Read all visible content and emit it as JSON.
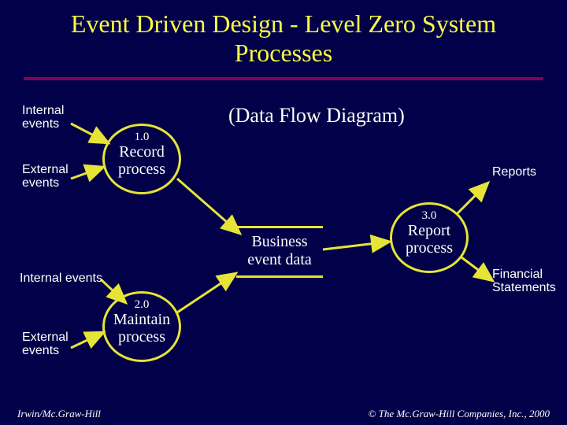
{
  "title": "Event Driven Design - Level Zero System Processes",
  "subtitle": "(Data Flow Diagram)",
  "labels": {
    "internal1": "Internal\nevents",
    "external1": "External\nevents",
    "internal2": "Internal events",
    "external2": "External\nevents",
    "reports": "Reports",
    "financial": "Financial\nStatements"
  },
  "processes": {
    "p1": {
      "id": "1.0",
      "name": "Record\nprocess"
    },
    "p2": {
      "id": "2.0",
      "name": "Maintain\nprocess"
    },
    "p3": {
      "id": "3.0",
      "name": "Report\nprocess"
    }
  },
  "datastore": {
    "name": "Business\nevent data"
  },
  "footer": {
    "left": "Irwin/Mc.Graw-Hill",
    "right": "© The Mc.Graw-Hill Companies, Inc., 2000"
  },
  "chart_data": {
    "type": "diagram",
    "title": "Event Driven Design - Level Zero System Processes (Data Flow Diagram)",
    "nodes": [
      {
        "id": "internal1",
        "type": "external-entity",
        "label": "Internal events"
      },
      {
        "id": "external1",
        "type": "external-entity",
        "label": "External events"
      },
      {
        "id": "internal2",
        "type": "external-entity",
        "label": "Internal events"
      },
      {
        "id": "external2",
        "type": "external-entity",
        "label": "External events"
      },
      {
        "id": "reports",
        "type": "external-entity",
        "label": "Reports"
      },
      {
        "id": "financial",
        "type": "external-entity",
        "label": "Financial Statements"
      },
      {
        "id": "p1",
        "type": "process",
        "number": "1.0",
        "label": "Record process"
      },
      {
        "id": "p2",
        "type": "process",
        "number": "2.0",
        "label": "Maintain process"
      },
      {
        "id": "p3",
        "type": "process",
        "number": "3.0",
        "label": "Report process"
      },
      {
        "id": "ds",
        "type": "data-store",
        "label": "Business event data"
      }
    ],
    "edges": [
      {
        "from": "internal1",
        "to": "p1"
      },
      {
        "from": "external1",
        "to": "p1"
      },
      {
        "from": "internal2",
        "to": "p2"
      },
      {
        "from": "external2",
        "to": "p2"
      },
      {
        "from": "p1",
        "to": "ds"
      },
      {
        "from": "p2",
        "to": "ds"
      },
      {
        "from": "ds",
        "to": "p3"
      },
      {
        "from": "p3",
        "to": "reports"
      },
      {
        "from": "p3",
        "to": "financial"
      }
    ]
  }
}
